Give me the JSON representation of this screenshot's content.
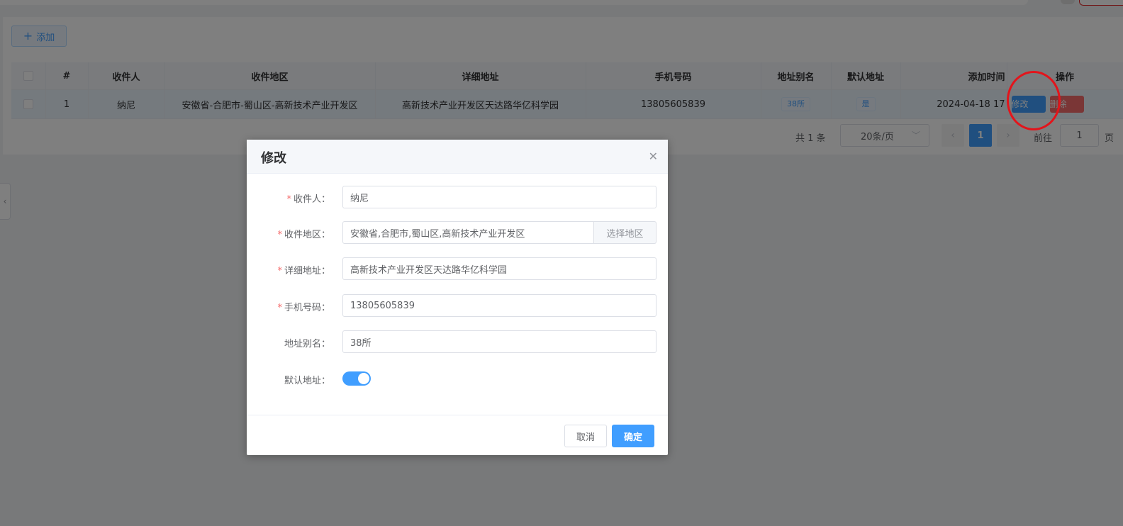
{
  "toolbar": {
    "add_label": "添加",
    "add_icon": "plus-icon"
  },
  "table": {
    "headers": [
      "#",
      "收件人",
      "收件地区",
      "详细地址",
      "手机号码",
      "地址别名",
      "默认地址",
      "添加时间",
      "操作"
    ],
    "rows": [
      {
        "index": "1",
        "recipient": "纳尼",
        "region": "安徽省-合肥市-蜀山区-高新技术产业开发区",
        "address": "高新技术产业开发区天达路华亿科学园",
        "phone": "13805605839",
        "alias": "38所",
        "is_default": "是",
        "added_time": "2024-04-18 17",
        "edit_label": "修改",
        "delete_label": "删除"
      }
    ]
  },
  "pagination": {
    "total": "共 1 条",
    "page_size": "20条/页",
    "current_page": "1",
    "goto_prefix": "前往",
    "goto_value": "1",
    "goto_suffix": "页"
  },
  "dialog": {
    "title": "修改",
    "fields": {
      "recipient": {
        "label": "收件人：",
        "value": "纳尼",
        "required": true
      },
      "region": {
        "label": "收件地区：",
        "value": "安徽省,合肥市,蜀山区,高新技术产业开发区",
        "append": "选择地区",
        "required": true
      },
      "address": {
        "label": "详细地址：",
        "value": "高新技术产业开发区天达路华亿科学园",
        "required": true
      },
      "phone": {
        "label": "手机号码：",
        "value": "13805605839",
        "required": true
      },
      "alias": {
        "label": "地址别名：",
        "value": "38所",
        "required": false
      },
      "is_default": {
        "label": "默认地址：",
        "enabled": true
      }
    },
    "cancel_label": "取消",
    "confirm_label": "确定"
  },
  "colors": {
    "primary": "#409eff",
    "danger": "#f56c6c",
    "annotation": "#e3141b"
  }
}
